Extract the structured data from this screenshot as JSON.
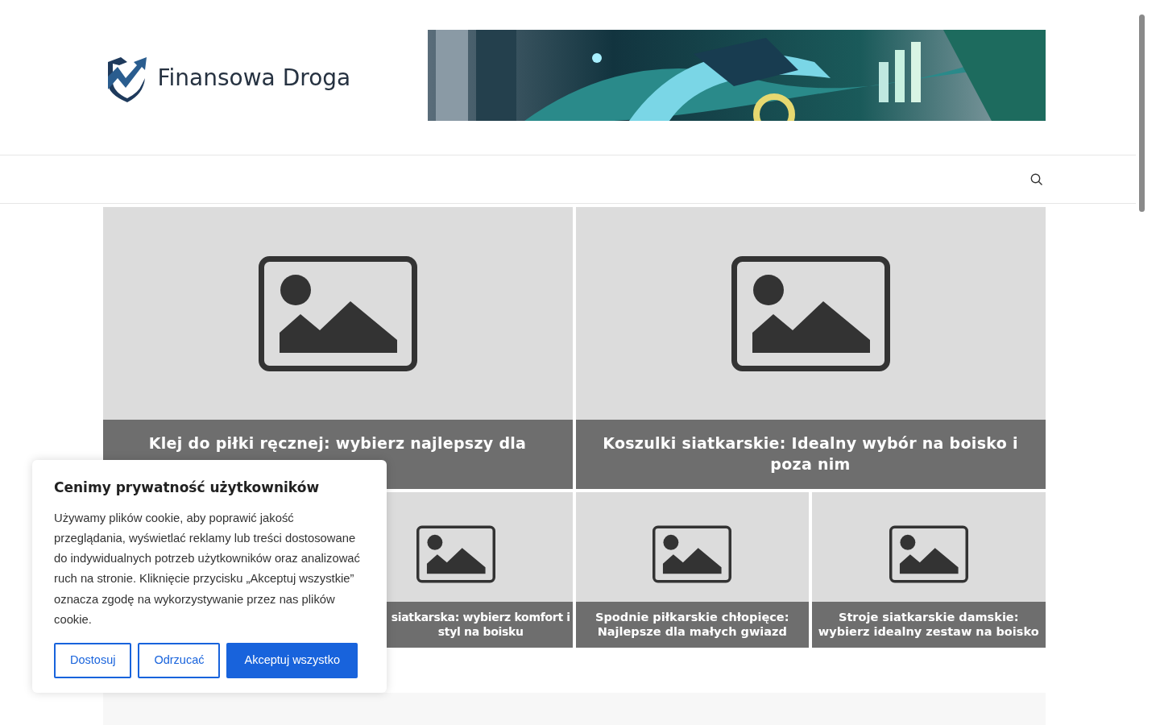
{
  "site": {
    "name": "Finansowa Droga"
  },
  "featured_large": [
    {
      "title": "Klej do piłki ręcznej: wybierz najlepszy dla"
    },
    {
      "title": "Koszulki siatkarskie: Idealny wybór na boisko i poza nim"
    }
  ],
  "featured_small": [
    {
      "title": "siatkarska: wybierz komfort i styl na boisku",
      "covered": true
    },
    {
      "title": "Spodnie piłkarskie chłopięce: Najlepsze dla małych gwiazd",
      "covered": false
    },
    {
      "title": "Stroje siatkarskie damskie: wybierz idealny zestaw na boisko",
      "covered": false
    }
  ],
  "cookie_notice": {
    "title": "Cenimy prywatność użytkowników",
    "text": "Używamy plików cookie, aby poprawić jakość przeglądania, wyświetlać reklamy lub treści dostosowane do indywidualnych potrzeb użytkowników oraz analizować ruch na stronie. Kliknięcie przycisku „Akceptuj wszystkie” oznacza zgodę na wykorzystywanie przez nas plików cookie.",
    "buttons": [
      {
        "label": "Dostosuj",
        "kind": "outline"
      },
      {
        "label": "Odrzucać",
        "kind": "outline"
      },
      {
        "label": "Akceptuj wszystko",
        "kind": "primary"
      }
    ]
  }
}
